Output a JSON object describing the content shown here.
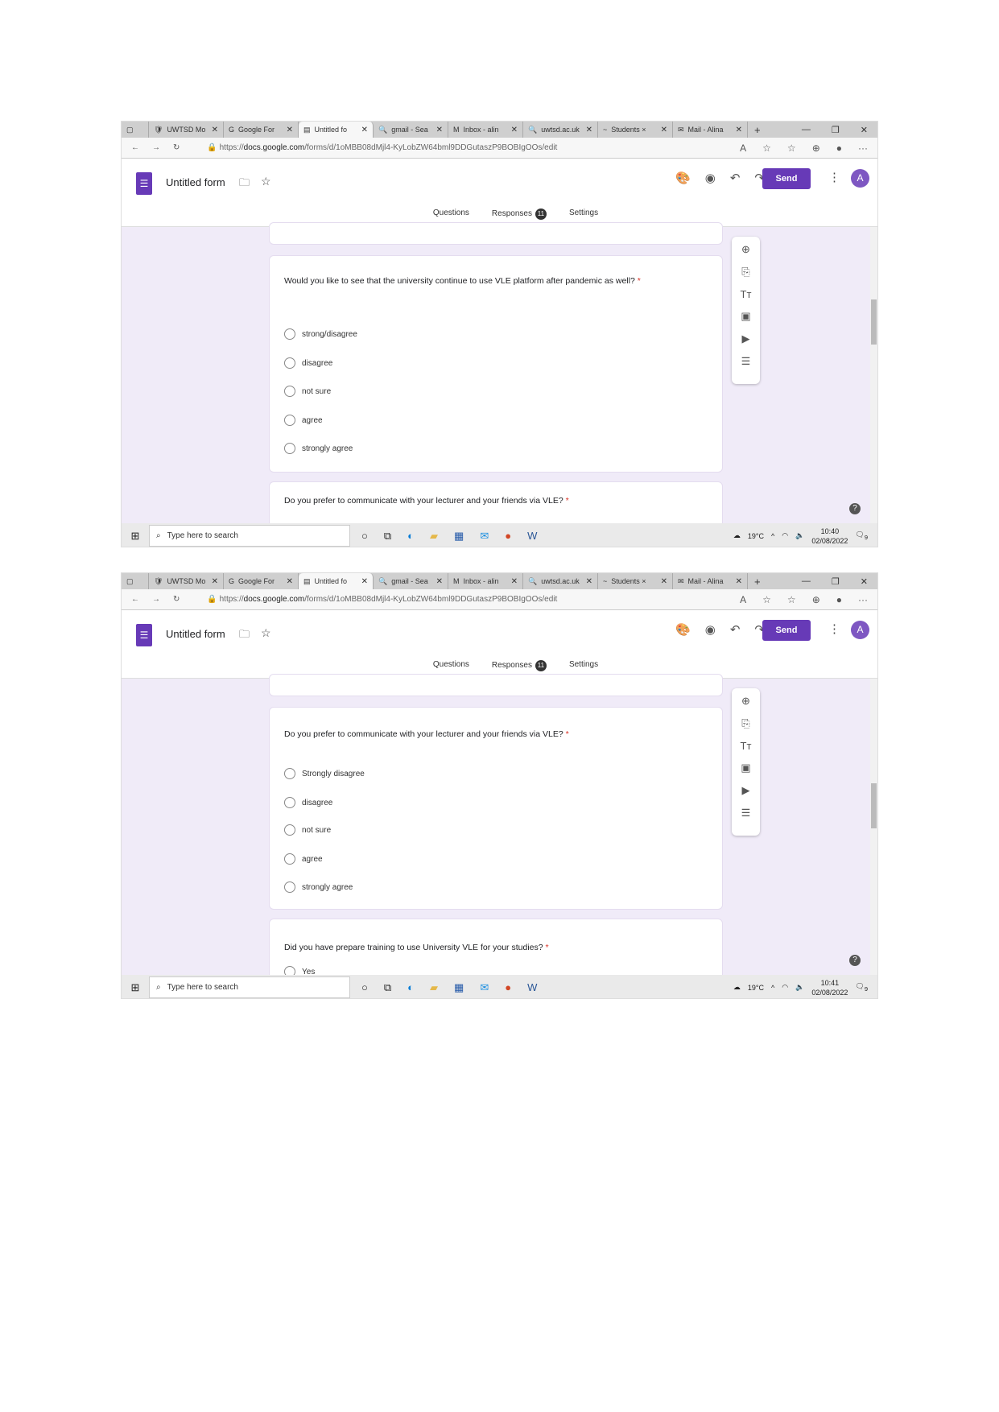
{
  "browser": {
    "tabs": [
      {
        "icon": "shield-icon",
        "label": "UWTSD Mo"
      },
      {
        "icon": "google-icon",
        "label": "Google For"
      },
      {
        "icon": "forms-icon",
        "label": "Untitled fo",
        "active": true
      },
      {
        "icon": "search-icon",
        "label": "gmail - Sea"
      },
      {
        "icon": "gmail-icon",
        "label": "Inbox - alin"
      },
      {
        "icon": "search-icon",
        "label": "uwtsd.ac.uk"
      },
      {
        "icon": "students-icon",
        "label": "Students ×"
      },
      {
        "icon": "outlook-icon",
        "label": "Mail - Alina"
      }
    ],
    "url_prefix": "https://",
    "url_domain": "docs.google.com",
    "url_path": "/forms/d/1oMBB08dMjl4-KyLobZW64bml9DDGutaszP9BOBIgOOs/edit"
  },
  "form": {
    "title": "Untitled form",
    "send_label": "Send",
    "avatar_letter": "A",
    "tabs": {
      "questions": "Questions",
      "responses": "Responses",
      "responses_count": "11",
      "settings": "Settings"
    },
    "accent": "#673ab7"
  },
  "taskbar": {
    "search_placeholder": "Type here to search",
    "temperature": "19°C",
    "date": "02/08/2022",
    "notifications": "9"
  },
  "screenshots": [
    {
      "time": "10:40",
      "questions": [
        {
          "text": "Would you like to see that the university continue to use VLE platform after pandemic as well?",
          "required": "*",
          "options": [
            "strong/disagree",
            "disagree",
            "not sure",
            "agree",
            "strongly agree"
          ]
        },
        {
          "text": "Do you prefer to communicate with your lecturer and your friends via VLE?",
          "required": "*",
          "options": []
        }
      ]
    },
    {
      "time": "10:41",
      "questions": [
        {
          "text": "Do you prefer to communicate with your lecturer and your friends via VLE?",
          "required": "*",
          "options": [
            "Strongly disagree",
            "disagree",
            "not sure",
            "agree",
            "strongly agree"
          ]
        },
        {
          "text": "Did you have prepare training to use University VLE for your studies?",
          "required": "*",
          "options": [
            "Yes"
          ]
        }
      ]
    }
  ]
}
